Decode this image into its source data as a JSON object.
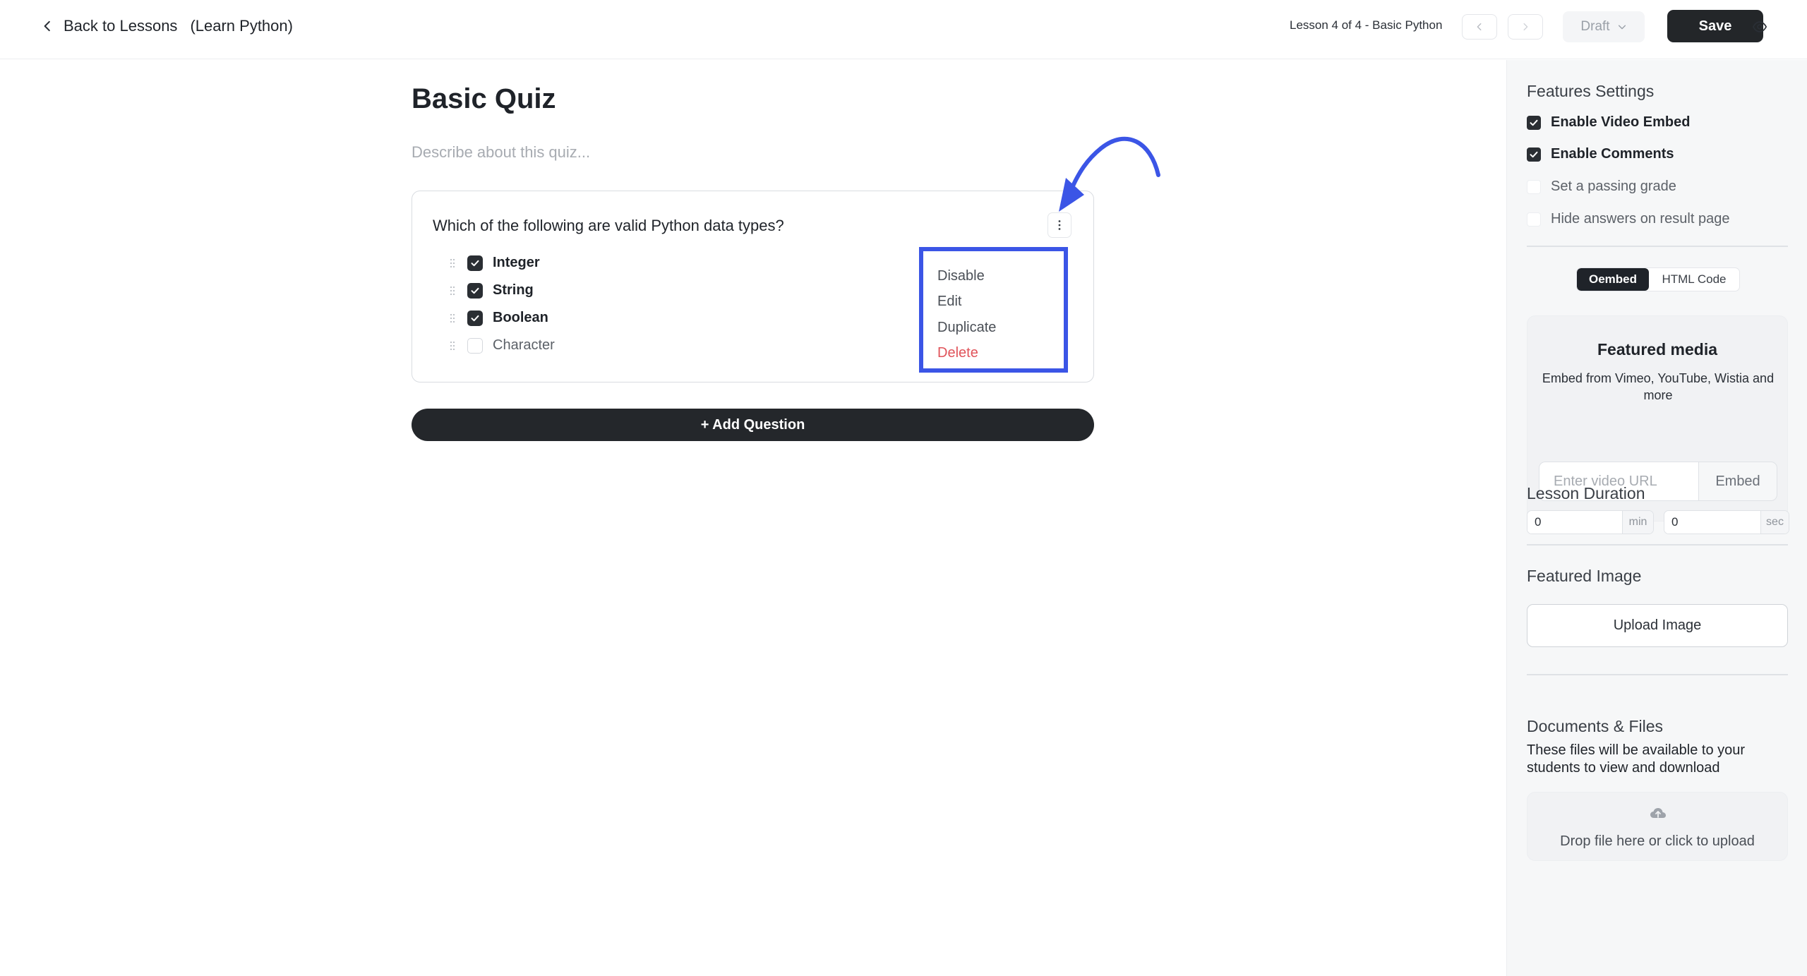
{
  "header": {
    "back_label": "Back to Lessons",
    "course_label": "(Learn Python)",
    "lesson_info": "Lesson 4 of 4 - Basic Python",
    "status_label": "Draft",
    "save_label": "Save"
  },
  "quiz": {
    "title": "Basic Quiz",
    "description_placeholder": "Describe about this quiz...",
    "question": "Which of the following are valid Python data types?",
    "options": [
      {
        "label": "Integer",
        "checked": true
      },
      {
        "label": "String",
        "checked": true
      },
      {
        "label": "Boolean",
        "checked": true
      },
      {
        "label": "Character",
        "checked": false
      }
    ],
    "menu": [
      "Disable",
      "Edit",
      "Duplicate",
      "Delete"
    ],
    "add_question_label": "+ Add Question"
  },
  "sidebar": {
    "features_title": "Features Settings",
    "features": [
      {
        "label": "Enable Video Embed",
        "checked": true
      },
      {
        "label": "Enable Comments",
        "checked": true
      },
      {
        "label": "Set a passing grade",
        "checked": false
      },
      {
        "label": "Hide answers on result page",
        "checked": false
      }
    ],
    "embed_tabs": {
      "oembed": "Oembed",
      "html": "HTML Code"
    },
    "media": {
      "title": "Featured media",
      "description": "Embed from Vimeo, YouTube, Wistia and more",
      "url_placeholder": "Enter video URL",
      "embed_label": "Embed"
    },
    "duration": {
      "title": "Lesson Duration",
      "minutes": "0",
      "min_unit": "min",
      "seconds": "0",
      "sec_unit": "sec"
    },
    "featured_image": {
      "title": "Featured Image",
      "upload_label": "Upload Image"
    },
    "docs": {
      "title": "Documents & Files",
      "description": "These files will be available to your students to view and download",
      "drop_label": "Drop file here or click to upload"
    }
  },
  "colors": {
    "accent_annotation": "#3b55e6",
    "danger": "#e0535a",
    "primary_dark": "#232629"
  }
}
